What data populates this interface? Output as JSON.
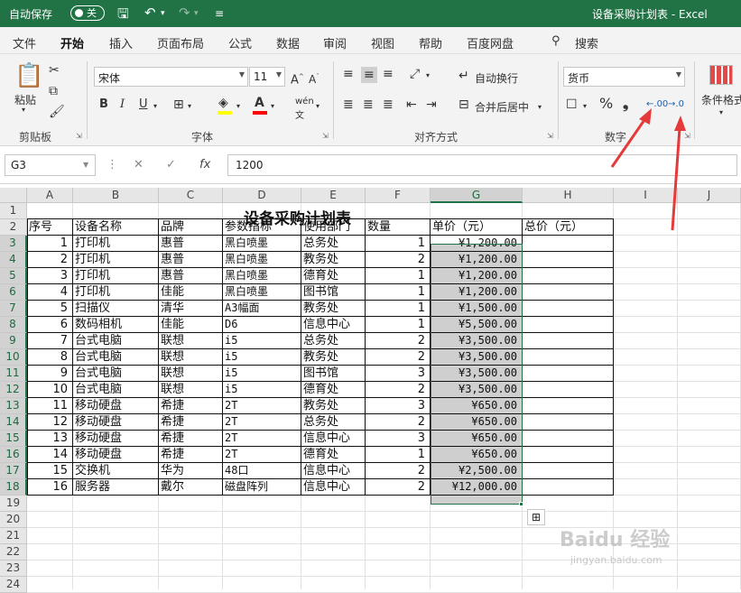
{
  "title_bar": {
    "autosave_label": "自动保存",
    "autosave_state": "关",
    "doc_title": "设备采购计划表  -  Excel"
  },
  "menu": [
    "文件",
    "开始",
    "插入",
    "页面布局",
    "公式",
    "数据",
    "审阅",
    "视图",
    "帮助",
    "百度网盘"
  ],
  "search_label": "搜索",
  "ribbon": {
    "paste_label": "粘贴",
    "clipboard_label": "剪贴板",
    "font_name": "宋体",
    "font_size": "11",
    "font_group_label": "字体",
    "bold": "B",
    "italic": "I",
    "underline": "U",
    "wrap_text": "自动换行",
    "merge_center": "合并后居中",
    "align_group_label": "对齐方式",
    "number_format": "货币",
    "percent": "%",
    "comma": "❟",
    "number_group_label": "数字",
    "cond_format": "条件格式",
    "inc_decimal": ".00",
    "dec_decimal": ".0",
    "font_color": "#ff0000",
    "fill_color": "#ffff00"
  },
  "formula_bar": {
    "name_box": "G3",
    "formula": "1200",
    "fx": "fx"
  },
  "columns": [
    "A",
    "B",
    "C",
    "D",
    "E",
    "F",
    "G",
    "H",
    "I",
    "J"
  ],
  "rows": [
    "1",
    "2",
    "3",
    "4",
    "5",
    "6",
    "7",
    "8",
    "9",
    "10",
    "11",
    "12",
    "13",
    "14",
    "15",
    "16",
    "17",
    "18",
    "19",
    "20",
    "21",
    "22",
    "23",
    "24"
  ],
  "sheet_title": "设备采购计划表",
  "headers": [
    "序号",
    "设备名称",
    "品牌",
    "参数指标",
    "使用部门",
    "数量",
    "单价（元）",
    "总价（元）"
  ],
  "data_rows": [
    [
      "1",
      "打印机",
      "惠普",
      "黑白喷墨",
      "总务处",
      "1",
      "¥1,200.00"
    ],
    [
      "2",
      "打印机",
      "惠普",
      "黑白喷墨",
      "教务处",
      "2",
      "¥1,200.00"
    ],
    [
      "3",
      "打印机",
      "惠普",
      "黑白喷墨",
      "德育处",
      "1",
      "¥1,200.00"
    ],
    [
      "4",
      "打印机",
      "佳能",
      "黑白喷墨",
      "图书馆",
      "1",
      "¥1,200.00"
    ],
    [
      "5",
      "扫描仪",
      "清华",
      "A3幅面",
      "教务处",
      "1",
      "¥1,500.00"
    ],
    [
      "6",
      "数码相机",
      "佳能",
      "D6",
      "信息中心",
      "1",
      "¥5,500.00"
    ],
    [
      "7",
      "台式电脑",
      "联想",
      "i5",
      "总务处",
      "2",
      "¥3,500.00"
    ],
    [
      "8",
      "台式电脑",
      "联想",
      "i5",
      "教务处",
      "2",
      "¥3,500.00"
    ],
    [
      "9",
      "台式电脑",
      "联想",
      "i5",
      "图书馆",
      "3",
      "¥3,500.00"
    ],
    [
      "10",
      "台式电脑",
      "联想",
      "i5",
      "德育处",
      "2",
      "¥3,500.00"
    ],
    [
      "11",
      "移动硬盘",
      "希捷",
      "2T",
      "教务处",
      "3",
      "¥650.00"
    ],
    [
      "12",
      "移动硬盘",
      "希捷",
      "2T",
      "总务处",
      "2",
      "¥650.00"
    ],
    [
      "13",
      "移动硬盘",
      "希捷",
      "2T",
      "信息中心",
      "3",
      "¥650.00"
    ],
    [
      "14",
      "移动硬盘",
      "希捷",
      "2T",
      "德育处",
      "1",
      "¥650.00"
    ],
    [
      "15",
      "交换机",
      "华为",
      "48口",
      "信息中心",
      "2",
      "¥2,500.00"
    ],
    [
      "16",
      "服务器",
      "戴尔",
      "磁盘阵列",
      "信息中心",
      "2",
      "¥12,000.00"
    ]
  ],
  "watermark": {
    "brand": "Baidu 经验",
    "url": "jingyan.baidu.com"
  }
}
